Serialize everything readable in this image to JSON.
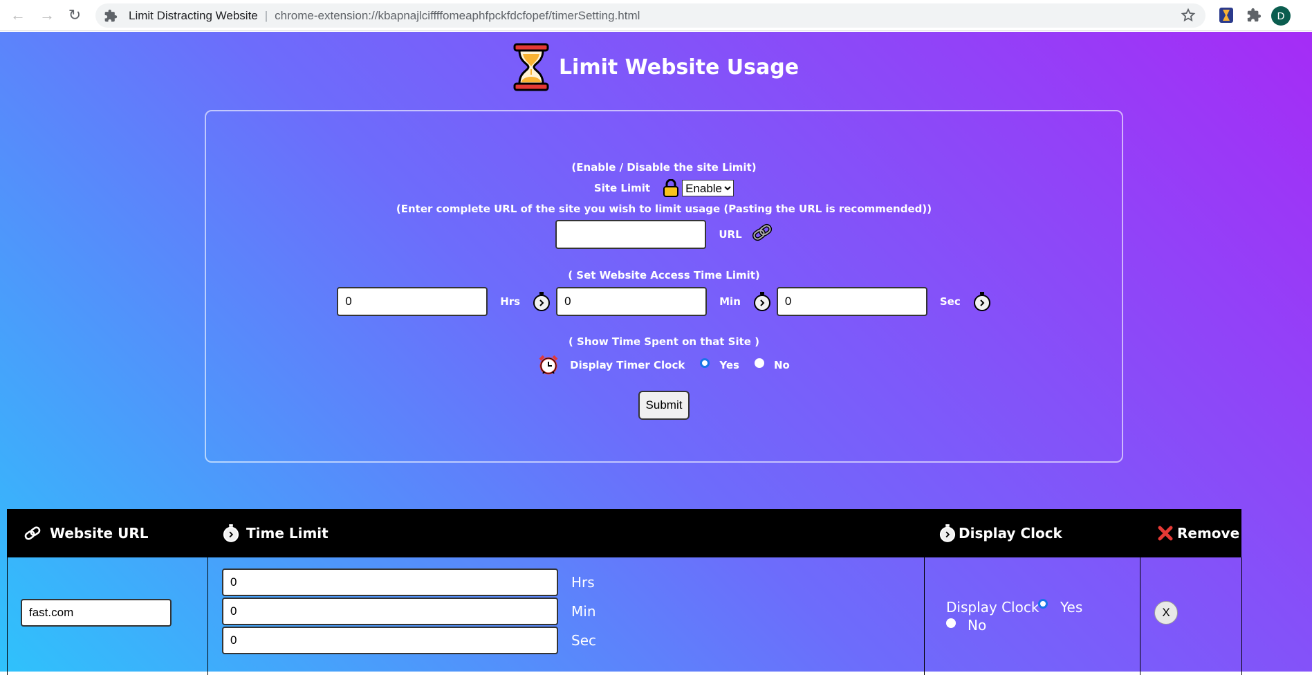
{
  "browser": {
    "site_name": "Limit Distracting Website",
    "separator": "|",
    "url": "chrome-extension://kbapnajlciffffomeaphfpckfdcfopef/timerSetting.html",
    "profile_initial": "D"
  },
  "header": {
    "title": "Limit Website Usage"
  },
  "settings": {
    "enable_hint": "(Enable / Disable the site Limit)",
    "site_limit_label": "Site Limit",
    "site_limit_value": "Enable",
    "url_hint": "(Enter complete URL of the site you wish to limit usage (Pasting the URL is recommended))",
    "url_value": "",
    "url_label": "URL",
    "time_hint": "( Set Website Access Time Limit)",
    "hrs_value": "0",
    "hrs_label": "Hrs",
    "min_value": "0",
    "min_label": "Min",
    "sec_value": "0",
    "sec_label": "Sec",
    "show_hint": "( Show Time Spent on that Site )",
    "display_timer_label": "Display Timer Clock",
    "yes_label": "Yes",
    "no_label": "No",
    "submit_label": "Submit"
  },
  "table": {
    "headers": {
      "website_url": "Website URL",
      "time_limit": "Time Limit",
      "display_clock": "Display Clock",
      "remove": "Remove"
    },
    "rows": [
      {
        "url": "fast.com",
        "hrs": "0",
        "min": "0",
        "sec": "0",
        "hrs_label": "Hrs",
        "min_label": "Min",
        "sec_label": "Sec",
        "display_clock_label": "Display Clock",
        "yes_label": "Yes",
        "no_label": "No",
        "remove_label": "X"
      }
    ]
  },
  "colors": {
    "gradient_start": "#2fc2fb",
    "gradient_mid": "#6d6cfb",
    "gradient_end": "#a52cf6",
    "header_bg": "#000000",
    "remove_icon": "#e53935",
    "radio_checked": "#1a73e8"
  }
}
